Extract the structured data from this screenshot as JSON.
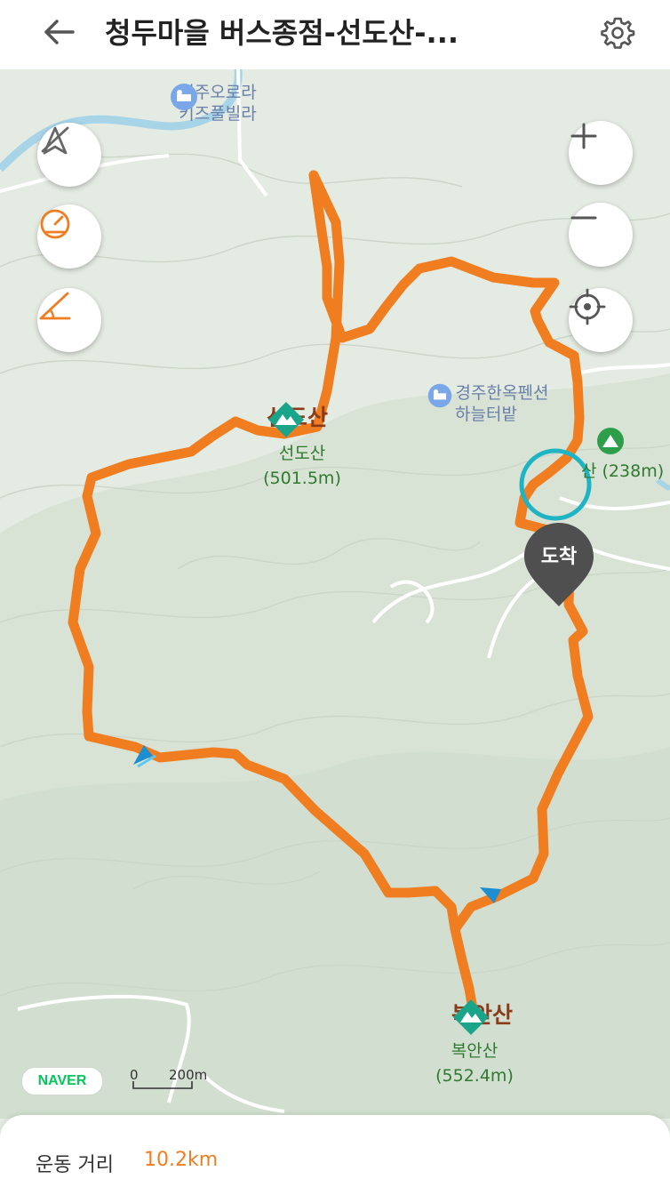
{
  "header": {
    "title": "청두마을 버스종점-선도산-...",
    "back_icon": "arrow-left-icon",
    "settings_icon": "gear-icon"
  },
  "map": {
    "route_color": "#f07e21",
    "pois": [
      {
        "line1": "경주오로라",
        "line2": "키즈풀빌라",
        "icon": "hotel-icon"
      },
      {
        "line1": "경주한옥펜션",
        "line2": "하늘터밭",
        "icon": "hotel-icon"
      }
    ],
    "peaks": [
      {
        "name": "선도산",
        "sub_name": "선도산",
        "elevation": "(501.5m)"
      },
      {
        "name": "복안산",
        "sub_name": "복안산",
        "elevation": "(552.4m)"
      }
    ],
    "partial_peak_label": "산 (238m)",
    "arrival_label": "도착",
    "scale": {
      "zero": "0",
      "distance": "200m"
    },
    "provider": "NAVER"
  },
  "controls": {
    "left": [
      {
        "name": "rotation-lock-icon"
      },
      {
        "name": "speedometer-icon"
      },
      {
        "name": "slope-icon"
      }
    ],
    "right": [
      {
        "name": "zoom-in-icon"
      },
      {
        "name": "zoom-out-icon"
      },
      {
        "name": "locate-icon"
      }
    ]
  },
  "summary": {
    "distance_label": "운동 거리",
    "distance_value": "10.2km"
  }
}
